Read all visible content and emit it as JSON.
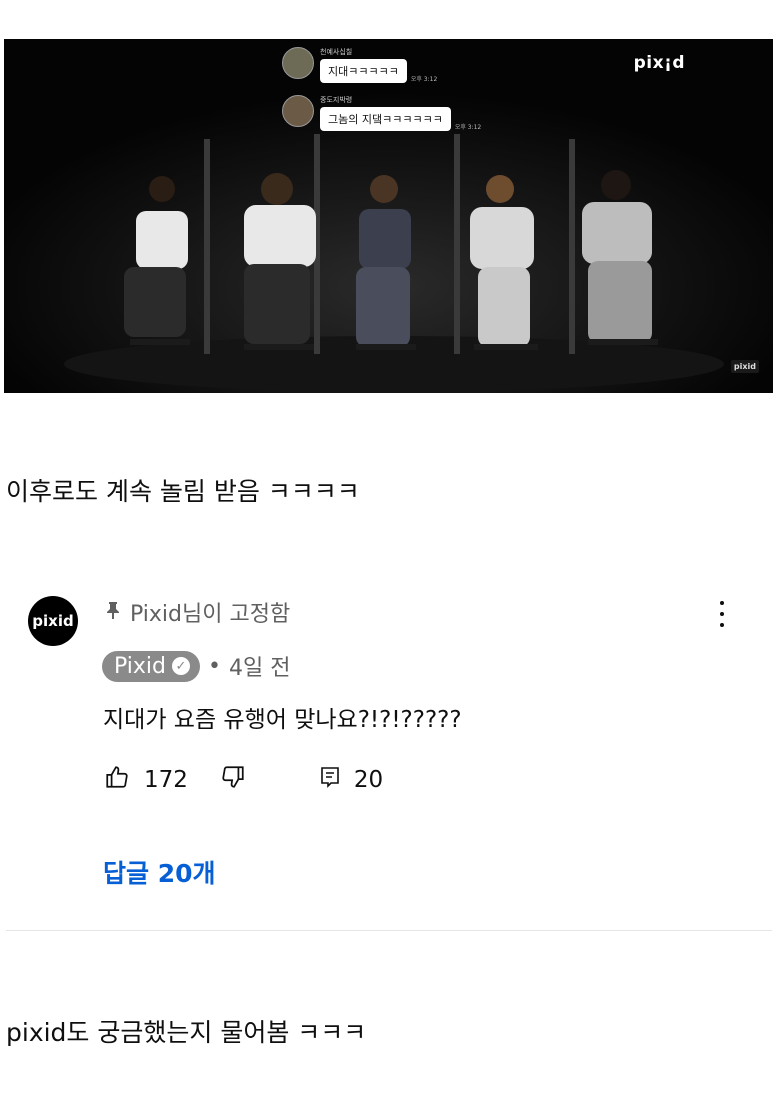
{
  "video": {
    "brand": "pix¡d",
    "brand_small": "pixid",
    "chat": [
      {
        "name": "천예사십칠",
        "message": "지대ㅋㅋㅋㅋㅋ",
        "time": "오후 3:12"
      },
      {
        "name": "중도지박령",
        "message": "그놈의 지댘ㅋㅋㅋㅋㅋㅋ",
        "time": "오후 3:12"
      }
    ]
  },
  "caption_1": "이후로도 계속 놀림 받음 ㅋㅋㅋㅋ",
  "comment": {
    "avatar_text": "pixid",
    "pinned_label": "Pixid님이 고정함",
    "author": "Pixid",
    "verified_mark": "✓",
    "dot": "•",
    "age": "4일 전",
    "text": "지대가 요즘 유행어 맞나요?!?!?????",
    "likes": "172",
    "reply_count": "20",
    "replies_link": "답글 20개"
  },
  "caption_2": "pixid도 궁금했는지 물어봄 ㅋㅋㅋ",
  "icons": {
    "pin": "pin-icon",
    "like": "thumbs-up-icon",
    "dislike": "thumbs-down-icon",
    "reply": "reply-icon",
    "more": "more-vert-icon"
  },
  "colors": {
    "link": "#065fd4",
    "chip": "#8a8a8a",
    "meta": "#606060"
  }
}
